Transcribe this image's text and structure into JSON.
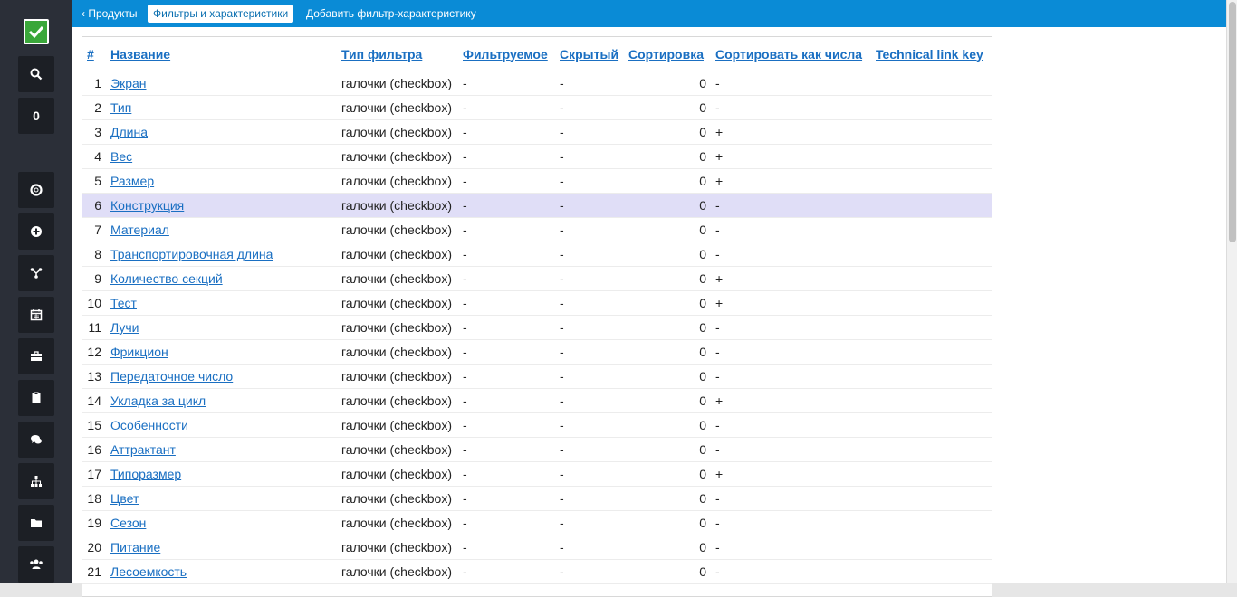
{
  "sidebar": {
    "counter_value": "0",
    "icons": [
      "search-icon",
      "life-ring-icon",
      "plus-circle-icon",
      "share-icon",
      "calendar-icon",
      "briefcase-icon",
      "clipboard-icon",
      "comments-icon",
      "sitemap-icon",
      "folder-icon",
      "users-icon"
    ]
  },
  "breadcrumb": {
    "products": "‹ Продукты",
    "current": "Фильтры и характеристики",
    "add": "Добавить фильтр-характеристику"
  },
  "table": {
    "headers": {
      "num": "#",
      "name": "Название",
      "type": "Тип фильтра",
      "filterable": "Фильтруемое",
      "hidden": "Скрытый",
      "sort": "Сортировка",
      "sort_numeric": "Сортировать как числа",
      "link_key": "Technical link key"
    },
    "rows": [
      {
        "num": "1",
        "name": "Экран",
        "type": "галочки (checkbox)",
        "filterable": "-",
        "hidden": "-",
        "sort": "0",
        "sort_numeric": "-",
        "link_key": ""
      },
      {
        "num": "2",
        "name": "Тип",
        "type": "галочки (checkbox)",
        "filterable": "-",
        "hidden": "-",
        "sort": "0",
        "sort_numeric": "-",
        "link_key": ""
      },
      {
        "num": "3",
        "name": "Длина",
        "type": "галочки (checkbox)",
        "filterable": "-",
        "hidden": "-",
        "sort": "0",
        "sort_numeric": "+",
        "link_key": ""
      },
      {
        "num": "4",
        "name": "Вес",
        "type": "галочки (checkbox)",
        "filterable": "-",
        "hidden": "-",
        "sort": "0",
        "sort_numeric": "+",
        "link_key": ""
      },
      {
        "num": "5",
        "name": "Размер",
        "type": "галочки (checkbox)",
        "filterable": "-",
        "hidden": "-",
        "sort": "0",
        "sort_numeric": "+",
        "link_key": ""
      },
      {
        "num": "6",
        "name": "Конструкция",
        "type": "галочки (checkbox)",
        "filterable": "-",
        "hidden": "-",
        "sort": "0",
        "sort_numeric": "-",
        "link_key": ""
      },
      {
        "num": "7",
        "name": "Материал",
        "type": "галочки (checkbox)",
        "filterable": "-",
        "hidden": "-",
        "sort": "0",
        "sort_numeric": "-",
        "link_key": ""
      },
      {
        "num": "8",
        "name": "Транспортировочная длина",
        "type": "галочки (checkbox)",
        "filterable": "-",
        "hidden": "-",
        "sort": "0",
        "sort_numeric": "-",
        "link_key": ""
      },
      {
        "num": "9",
        "name": "Количество секций",
        "type": "галочки (checkbox)",
        "filterable": "-",
        "hidden": "-",
        "sort": "0",
        "sort_numeric": "+",
        "link_key": ""
      },
      {
        "num": "10",
        "name": "Тест",
        "type": "галочки (checkbox)",
        "filterable": "-",
        "hidden": "-",
        "sort": "0",
        "sort_numeric": "+",
        "link_key": ""
      },
      {
        "num": "11",
        "name": "Лучи",
        "type": "галочки (checkbox)",
        "filterable": "-",
        "hidden": "-",
        "sort": "0",
        "sort_numeric": "-",
        "link_key": ""
      },
      {
        "num": "12",
        "name": "Фрикцион",
        "type": "галочки (checkbox)",
        "filterable": "-",
        "hidden": "-",
        "sort": "0",
        "sort_numeric": "-",
        "link_key": ""
      },
      {
        "num": "13",
        "name": "Передаточное число",
        "type": "галочки (checkbox)",
        "filterable": "-",
        "hidden": "-",
        "sort": "0",
        "sort_numeric": "-",
        "link_key": ""
      },
      {
        "num": "14",
        "name": "Укладка за цикл",
        "type": "галочки (checkbox)",
        "filterable": "-",
        "hidden": "-",
        "sort": "0",
        "sort_numeric": "+",
        "link_key": ""
      },
      {
        "num": "15",
        "name": "Особенности",
        "type": "галочки (checkbox)",
        "filterable": "-",
        "hidden": "-",
        "sort": "0",
        "sort_numeric": "-",
        "link_key": ""
      },
      {
        "num": "16",
        "name": "Аттрактант",
        "type": "галочки (checkbox)",
        "filterable": "-",
        "hidden": "-",
        "sort": "0",
        "sort_numeric": "-",
        "link_key": ""
      },
      {
        "num": "17",
        "name": "Типоразмер",
        "type": "галочки (checkbox)",
        "filterable": "-",
        "hidden": "-",
        "sort": "0",
        "sort_numeric": "+",
        "link_key": ""
      },
      {
        "num": "18",
        "name": "Цвет",
        "type": "галочки (checkbox)",
        "filterable": "-",
        "hidden": "-",
        "sort": "0",
        "sort_numeric": "-",
        "link_key": ""
      },
      {
        "num": "19",
        "name": "Сезон",
        "type": "галочки (checkbox)",
        "filterable": "-",
        "hidden": "-",
        "sort": "0",
        "sort_numeric": "-",
        "link_key": ""
      },
      {
        "num": "20",
        "name": "Питание",
        "type": "галочки (checkbox)",
        "filterable": "-",
        "hidden": "-",
        "sort": "0",
        "sort_numeric": "-",
        "link_key": ""
      },
      {
        "num": "21",
        "name": "Лесоемкость",
        "type": "галочки (checkbox)",
        "filterable": "-",
        "hidden": "-",
        "sort": "0",
        "sort_numeric": "-",
        "link_key": ""
      }
    ]
  },
  "colors": {
    "topbar": "#0a8bd6",
    "sidebar": "#2b2f38",
    "link": "#1a6fc2",
    "highlight_row": "#e0def7",
    "logo_green": "#3aa73a"
  }
}
